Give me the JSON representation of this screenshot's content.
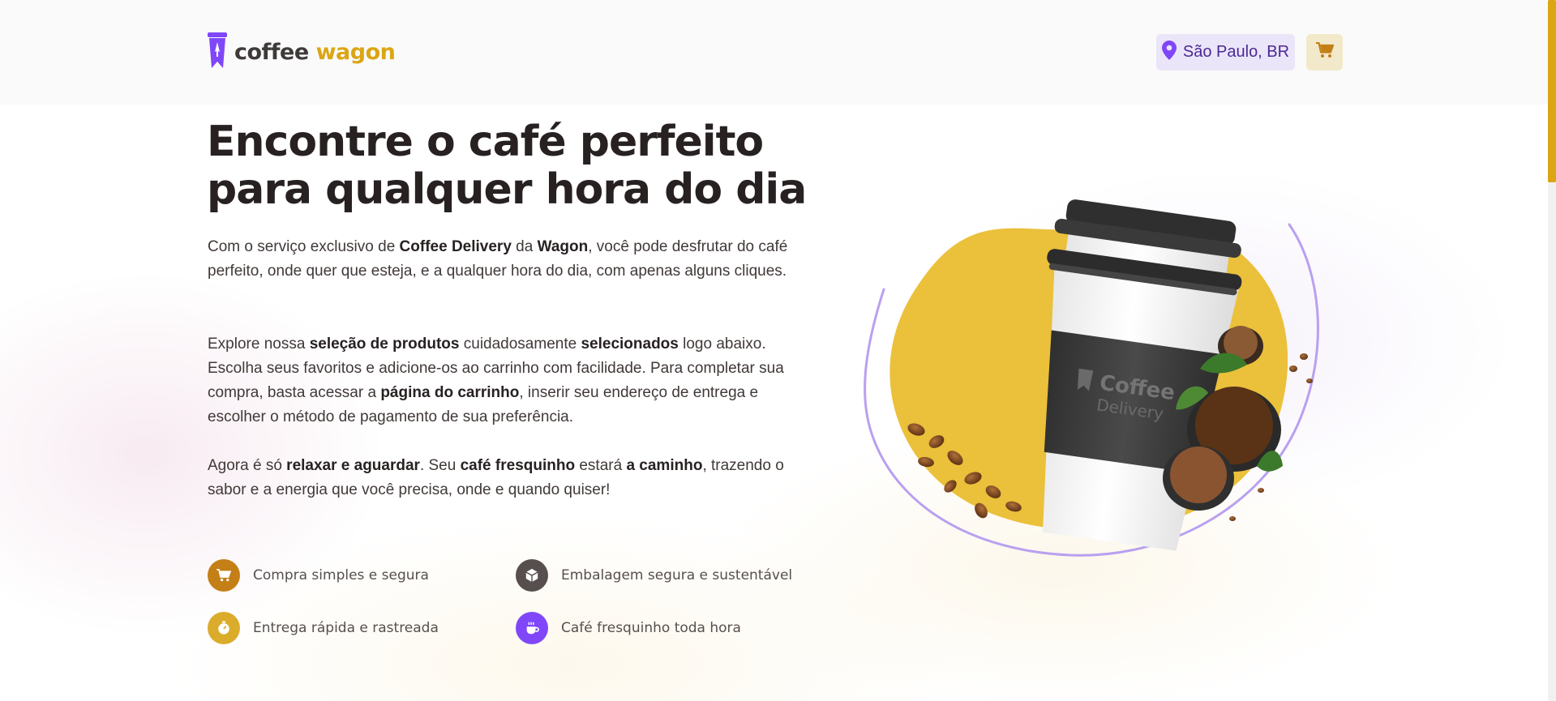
{
  "header": {
    "logo": {
      "word1": "coffee",
      "word2": "wagon",
      "icon": "coffee-cup-rocket-icon"
    },
    "location": {
      "label": "São Paulo, BR",
      "icon": "map-pin-icon"
    },
    "cart": {
      "icon": "shopping-cart-icon"
    }
  },
  "hero": {
    "title_line1": "Encontre o café perfeito",
    "title_line2": "para qualquer hora do dia",
    "p1": {
      "t1": "Com o serviço exclusivo de ",
      "b1": "Coffee Delivery",
      "t2": " da ",
      "b2": "Wagon",
      "t3": ", você pode desfrutar do café perfeito, onde quer que esteja, e a qualquer hora do dia, com apenas alguns cliques."
    },
    "p2": {
      "t1": "Explore nossa ",
      "b1": "seleção de produtos",
      "t2": " cuidadosamente ",
      "b2": "selecionados",
      "t3": " logo abaixo. Escolha seus favoritos e adicione-os ao carrinho com facilidade. Para completar sua compra, basta acessar a ",
      "b3": "página do carrinho",
      "t4": ", inserir seu endereço de entrega e escolher o método de pagamento de sua preferência."
    },
    "p3": {
      "t1": "Agora é só ",
      "b1": "relaxar e aguardar",
      "t2": ". Seu ",
      "b2": "café fresquinho",
      "t3": " estará ",
      "b3": "a caminho",
      "t4": ", trazendo o sabor e a energia que você precisa, onde e quando quiser!"
    },
    "cup_label": {
      "l1": "Coffee",
      "l2": "Delivery"
    }
  },
  "features": [
    {
      "label": "Compra simples e segura",
      "icon": "shopping-cart-icon",
      "color": "#c47f17"
    },
    {
      "label": "Embalagem segura e sustentável",
      "icon": "package-icon",
      "color": "#574f4d"
    },
    {
      "label": "Entrega rápida e rastreada",
      "icon": "timer-icon",
      "color": "#dbac2c"
    },
    {
      "label": "Café fresquinho toda hora",
      "icon": "coffee-icon",
      "color": "#8047f8"
    }
  ],
  "colors": {
    "brand_yellow": "#dba514",
    "brand_purple": "#8047f8",
    "blob_yellow": "#ebc03a",
    "title": "#272221"
  }
}
